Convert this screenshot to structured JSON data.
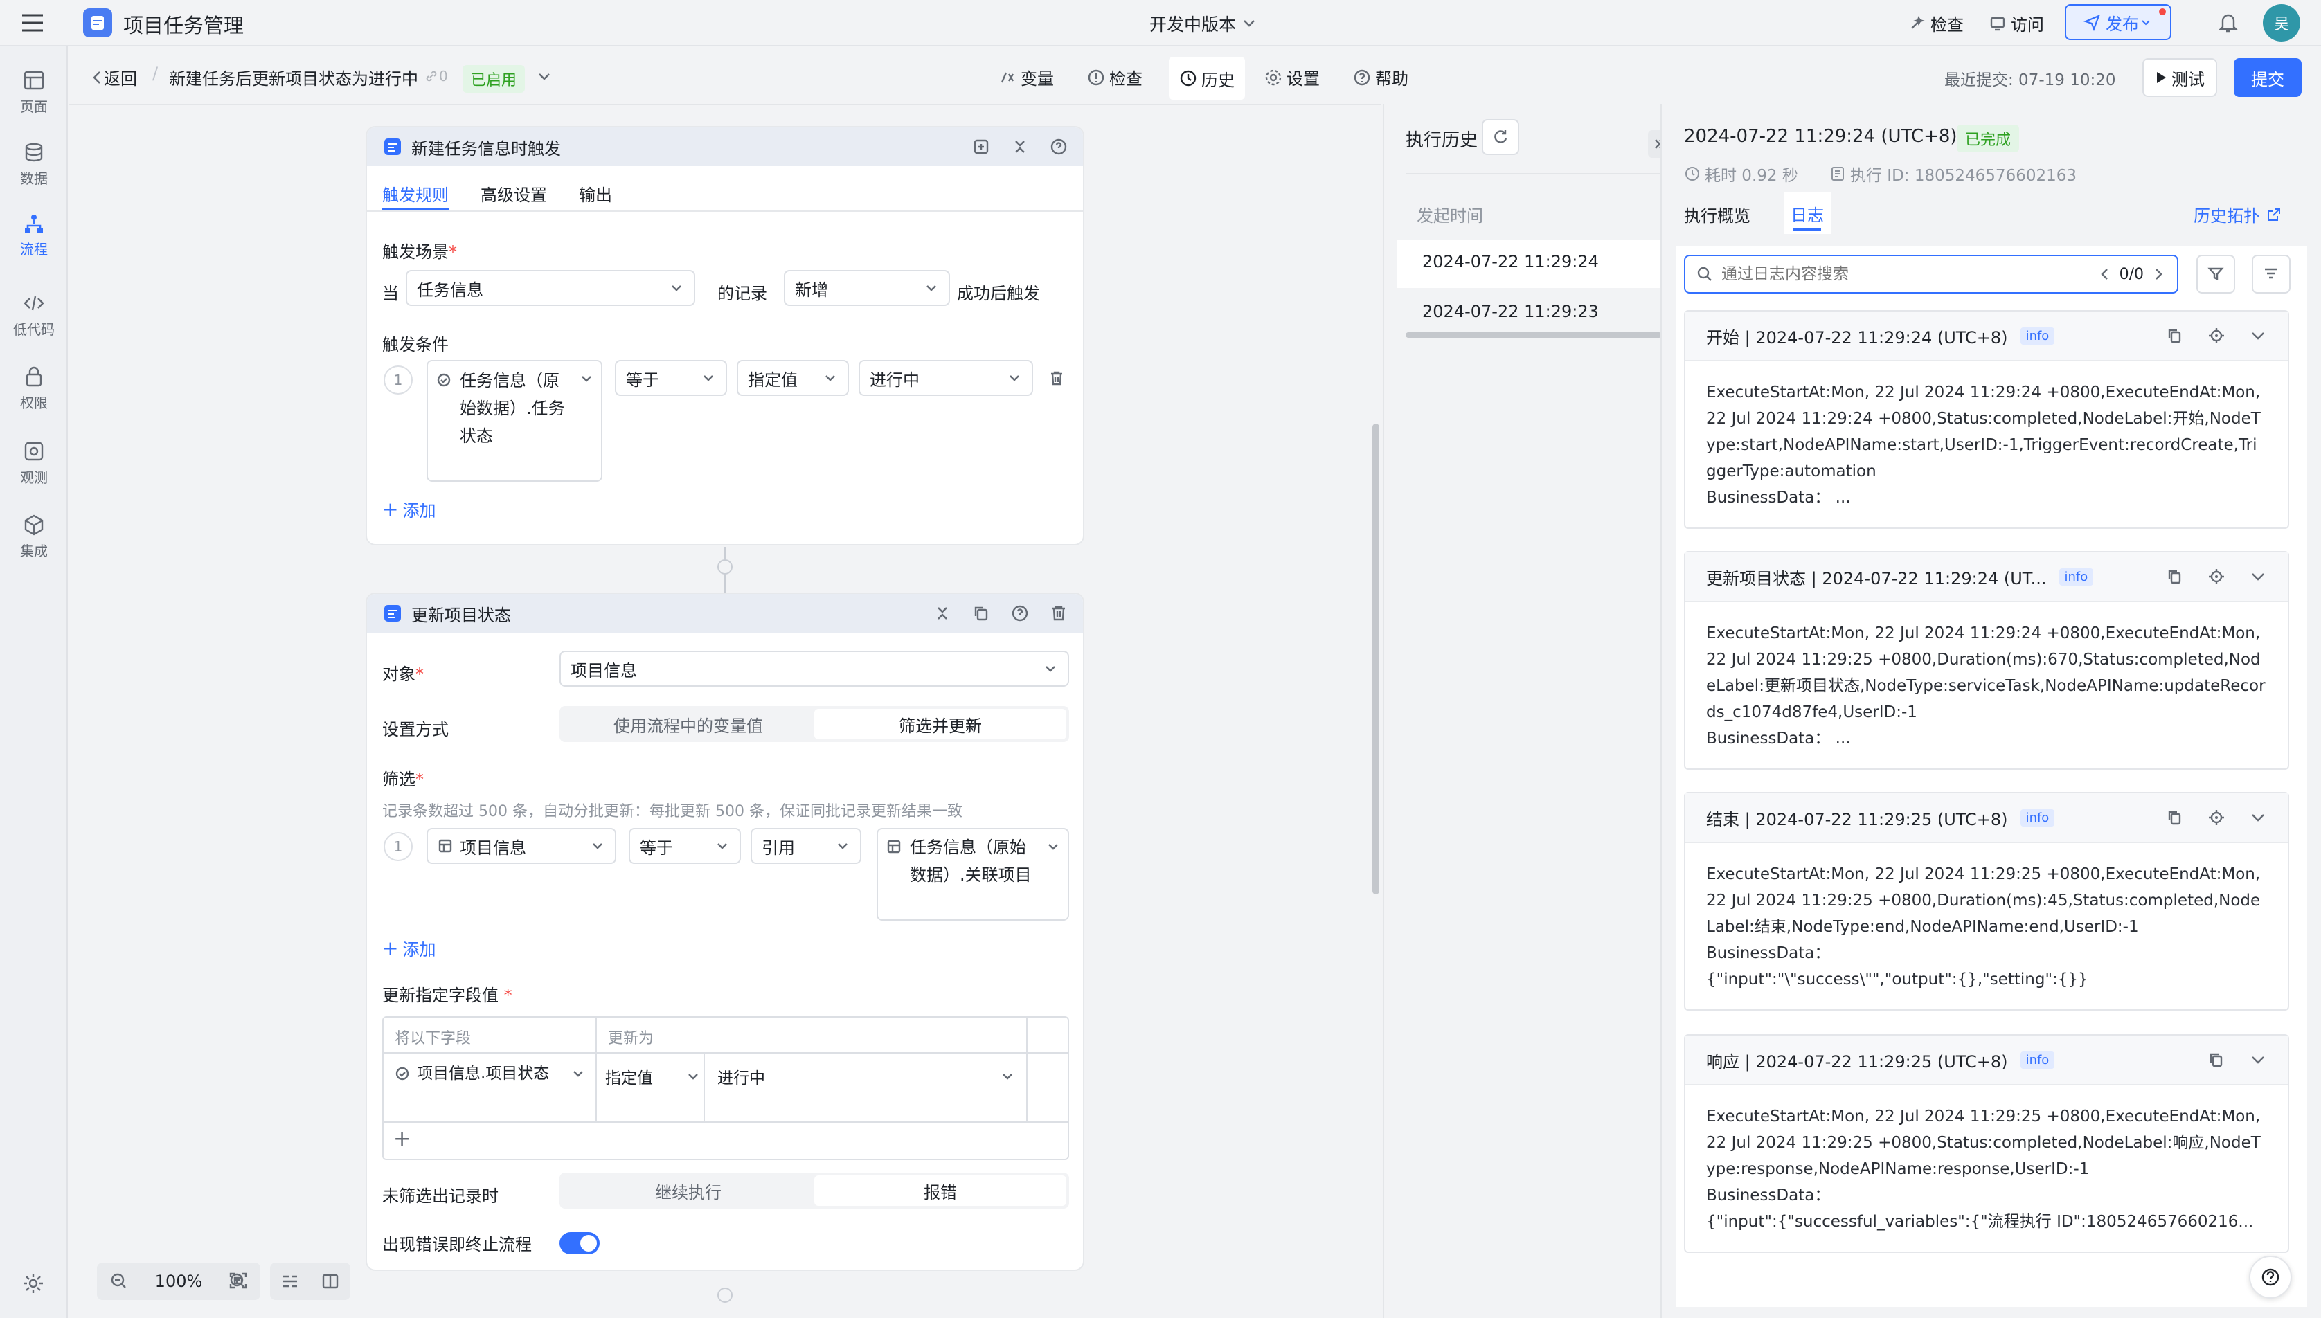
{
  "app": {
    "title": "项目任务管理",
    "version": "开发中版本",
    "check": "检查",
    "visit": "访问",
    "publish": "发布",
    "avatar": "吴"
  },
  "nav": [
    {
      "label": "页面"
    },
    {
      "label": "数据"
    },
    {
      "label": "流程"
    },
    {
      "label": "低代码"
    },
    {
      "label": "权限"
    },
    {
      "label": "观测"
    },
    {
      "label": "集成"
    }
  ],
  "subbar": {
    "back": "返回",
    "flow_name": "新建任务后更新项目状态为进行中",
    "version_count": "0",
    "status": "已启用",
    "tools": [
      "变量",
      "检查",
      "历史",
      "设置",
      "帮助"
    ],
    "last_submit": "最近提交: 07-19 10:20",
    "test": "测试",
    "submit": "提交"
  },
  "trigger": {
    "title": "新建任务信息时触发",
    "tabs": [
      "触发规则",
      "高级设置",
      "输出"
    ],
    "scene_label": "触发场景",
    "when": "当",
    "object": "任务信息",
    "of_record": "的记录",
    "action": "新增",
    "after": "成功后触发",
    "cond_label": "触发条件",
    "index": "1",
    "field": "任务信息（原始数据）.任务状态",
    "op": "等于",
    "vtype": "指定值",
    "value": "进行中",
    "add": "添加"
  },
  "update": {
    "title": "更新项目状态",
    "obj_label": "对象",
    "obj_value": "项目信息",
    "mode_label": "设置方式",
    "mode_opts": [
      "使用流程中的变量值",
      "筛选并更新"
    ],
    "filter_label": "筛选",
    "filter_hint": "记录条数超过 500 条，自动分批更新：每批更新 500 条，保证同批记录更新结果一致",
    "index": "1",
    "f_field": "项目信息",
    "f_op": "等于",
    "f_ref": "引用",
    "f_value": "任务信息（原始数据）.关联项目",
    "add": "添加",
    "fields_label": "更新指定字段值",
    "col1": "将以下字段",
    "col2": "更新为",
    "row_field": "项目信息.项目状态",
    "row_type": "指定值",
    "row_value": "进行中",
    "none_label": "未筛选出记录时",
    "none_opts": [
      "继续执行",
      "报错"
    ],
    "err_label": "出现错误即终止流程"
  },
  "zoom": "100%",
  "history": {
    "title": "执行历史",
    "col": "发起时间",
    "rows": [
      "2024-07-22 11:29:24",
      "2024-07-22 11:29:23"
    ]
  },
  "detail": {
    "time": "2024-07-22 11:29:24 (UTC+8)",
    "status": "已完成",
    "duration": "耗时 0.92 秒",
    "exec_id": "执行 ID: 1805246576602163",
    "tabs": [
      "执行概览",
      "日志"
    ],
    "topo": "历史拓扑",
    "search_placeholder": "通过日志内容搜索",
    "counter": "0/0"
  },
  "logs": [
    {
      "title": "开始 | 2024-07-22 11:29:24 (UTC+8)",
      "level": "info",
      "body": "ExecuteStartAt:Mon, 22 Jul 2024 11:29:24 +0800,ExecuteEndAt:Mon, 22 Jul 2024 11:29:24 +0800,Status:completed,NodeLabel:开始,NodeType:start,NodeAPIName:start,UserID:-1,TriggerEvent:recordCreate,TriggerType:automation",
      "data": "BusinessData： ..."
    },
    {
      "title": "更新项目状态 | 2024-07-22 11:29:24 (UT...",
      "level": "info",
      "body": "ExecuteStartAt:Mon, 22 Jul 2024 11:29:24 +0800,ExecuteEndAt:Mon, 22 Jul 2024 11:29:25 +0800,Duration(ms):670,Status:completed,NodeLabel:更新项目状态,NodeType:serviceTask,NodeAPIName:updateRecords_c1074d87fe4,UserID:-1",
      "data": "BusinessData： ..."
    },
    {
      "title": "结束 | 2024-07-22 11:29:25 (UTC+8)",
      "level": "info",
      "body": "ExecuteStartAt:Mon, 22 Jul 2024 11:29:25 +0800,ExecuteEndAt:Mon, 22 Jul 2024 11:29:25 +0800,Duration(ms):45,Status:completed,NodeLabel:结束,NodeType:end,NodeAPIName:end,UserID:-1",
      "data": "BusinessData：",
      "data2": "{\"input\":\"\\\"success\\\"\",\"output\":{},\"setting\":{}}"
    },
    {
      "title": "响应 | 2024-07-22 11:29:25 (UTC+8)",
      "level": "info",
      "body": "ExecuteStartAt:Mon, 22 Jul 2024 11:29:25 +0800,ExecuteEndAt:Mon, 22 Jul 2024 11:29:25 +0800,Status:completed,NodeLabel:响应,NodeType:response,NodeAPIName:response,UserID:-1",
      "data": "BusinessData：",
      "data2": "{\"input\":{\"successful_variables\":{\"流程执行 ID\":180524657660216..."
    }
  ]
}
